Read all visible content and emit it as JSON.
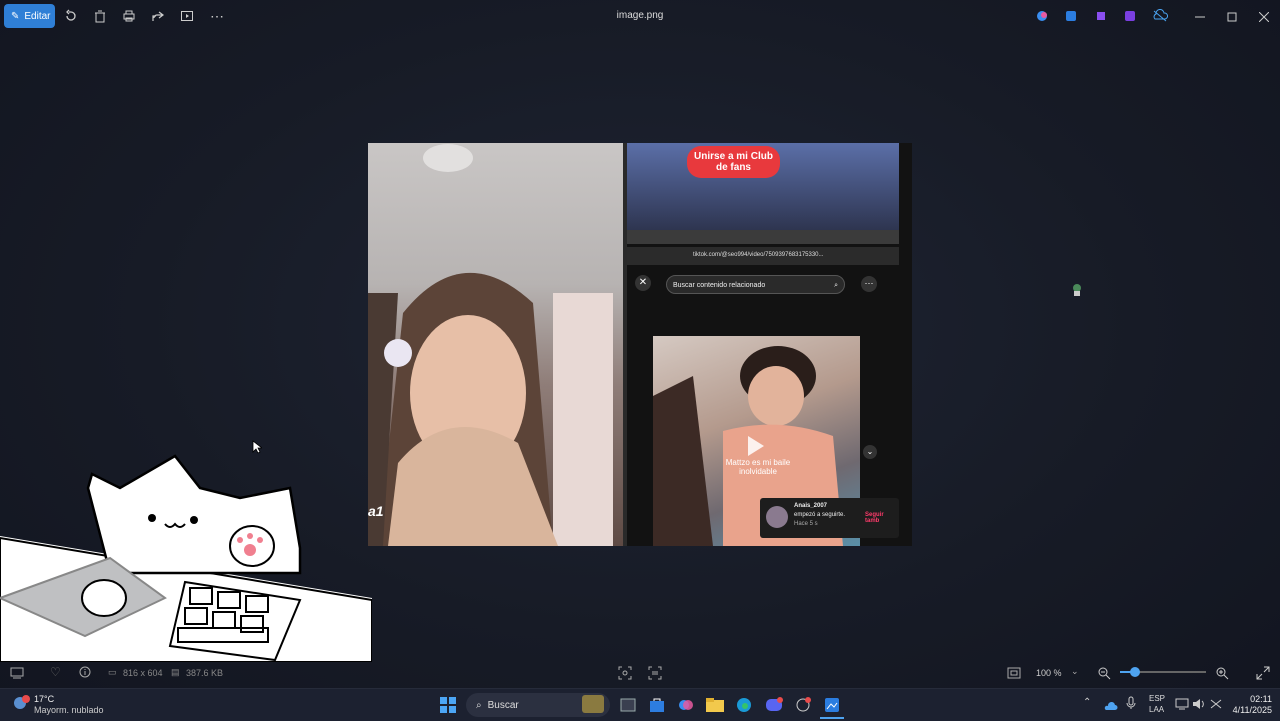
{
  "toolbar": {
    "edit_label": "Editar",
    "title": "image.png"
  },
  "photo": {
    "fanclub_text": "Unirse a mi Club de fans",
    "address_text": "tiktok.com/@seo994/video/7509397683175330...",
    "search_related_placeholder": "Buscar contenido relacionado",
    "video_caption": "Mattzo es mi baile inolvidable",
    "left_overlay_text": "a1",
    "notification": {
      "user": "Anais_2007",
      "action": "empezó a seguirte.",
      "time": "Hace 5 s",
      "button": "Seguir tamb"
    }
  },
  "statusbar": {
    "dimensions": "816 x 604",
    "filesize": "387.6 KB",
    "zoom": "100 %"
  },
  "taskbar": {
    "weather_temp": "17°C",
    "weather_desc": "Mayorm. nublado",
    "search_label": "Buscar",
    "lang_top": "ESP",
    "lang_bottom": "LAA",
    "time": "02:11",
    "date": "4/11/2025"
  },
  "colors": {
    "accent": "#2f7fd6",
    "taskbar": "#1c2130",
    "fanclub": "#e8393d"
  }
}
